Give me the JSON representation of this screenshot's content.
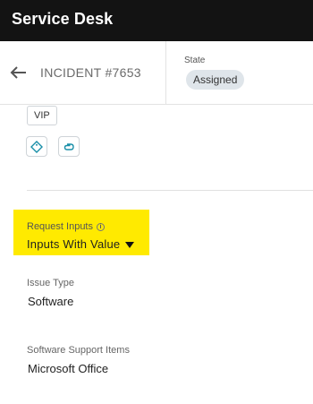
{
  "app": {
    "title": "Service Desk"
  },
  "header": {
    "incident_label": "INCIDENT #7653",
    "state_label": "State",
    "state_value": "Assigned"
  },
  "tags": {
    "vip_label": "VIP"
  },
  "icons": {
    "tag": "tag-icon",
    "attach": "paperclip-icon",
    "back": "arrow-left-icon",
    "info": "info-icon",
    "caret": "caret-down-icon"
  },
  "request_inputs": {
    "label": "Request Inputs",
    "info_glyph": "i",
    "selected": "Inputs With Value"
  },
  "fields": [
    {
      "label": "Issue Type",
      "value": "Software"
    },
    {
      "label": "Software Support Items",
      "value": "Microsoft Office"
    }
  ],
  "colors": {
    "appbar": "#131313",
    "highlight": "#ffea00",
    "badge_bg": "#dfe5ea",
    "icon_accent": "#1a8fa8"
  }
}
